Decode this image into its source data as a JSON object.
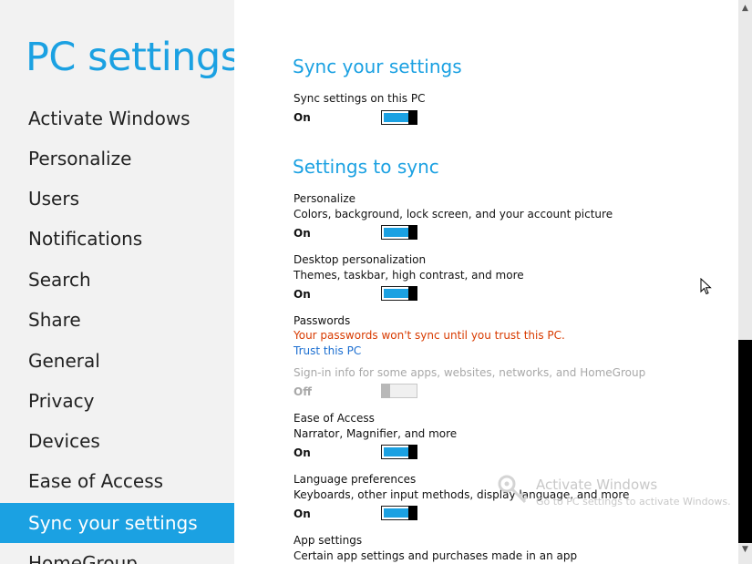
{
  "app": {
    "title": "PC settings"
  },
  "nav": {
    "items": [
      {
        "label": "Activate Windows"
      },
      {
        "label": "Personalize"
      },
      {
        "label": "Users"
      },
      {
        "label": "Notifications"
      },
      {
        "label": "Search"
      },
      {
        "label": "Share"
      },
      {
        "label": "General"
      },
      {
        "label": "Privacy"
      },
      {
        "label": "Devices"
      },
      {
        "label": "Ease of Access"
      },
      {
        "label": "Sync your settings",
        "selected": true
      },
      {
        "label": "HomeGroup"
      }
    ]
  },
  "main": {
    "section1": {
      "title": "Sync your settings",
      "sync_label": "Sync settings on this PC",
      "sync_state": "On"
    },
    "section2": {
      "title": "Settings to sync",
      "personalize": {
        "label": "Personalize",
        "description": "Colors, background, lock screen, and your account picture",
        "state": "On"
      },
      "desktop": {
        "label": "Desktop personalization",
        "description": "Themes, taskbar, high contrast, and more",
        "state": "On"
      },
      "passwords": {
        "label": "Passwords",
        "warning": "Your passwords won't sync until you trust this PC.",
        "link": "Trust this PC",
        "description": "Sign-in info for some apps, websites, networks, and HomeGroup",
        "state": "Off"
      },
      "ease": {
        "label": "Ease of Access",
        "description": "Narrator, Magnifier, and more",
        "state": "On"
      },
      "language": {
        "label": "Language preferences",
        "description": "Keyboards, other input methods, display language, and more",
        "state": "On"
      },
      "app_settings": {
        "label": "App settings",
        "description": "Certain app settings and purchases made in an app"
      }
    }
  },
  "watermark": {
    "title": "Activate Windows",
    "subtitle": "Go to PC settings to activate Windows."
  },
  "colors": {
    "accent": "#1ba1e2",
    "warning": "#d83b01",
    "link": "#1c6fd1",
    "left_pane": "#f2f2f2"
  },
  "icons": {
    "watermark": "key-icon",
    "scroll_up": "chevron-up-icon",
    "scroll_down": "chevron-down-icon",
    "cursor": "mouse-pointer-icon"
  }
}
